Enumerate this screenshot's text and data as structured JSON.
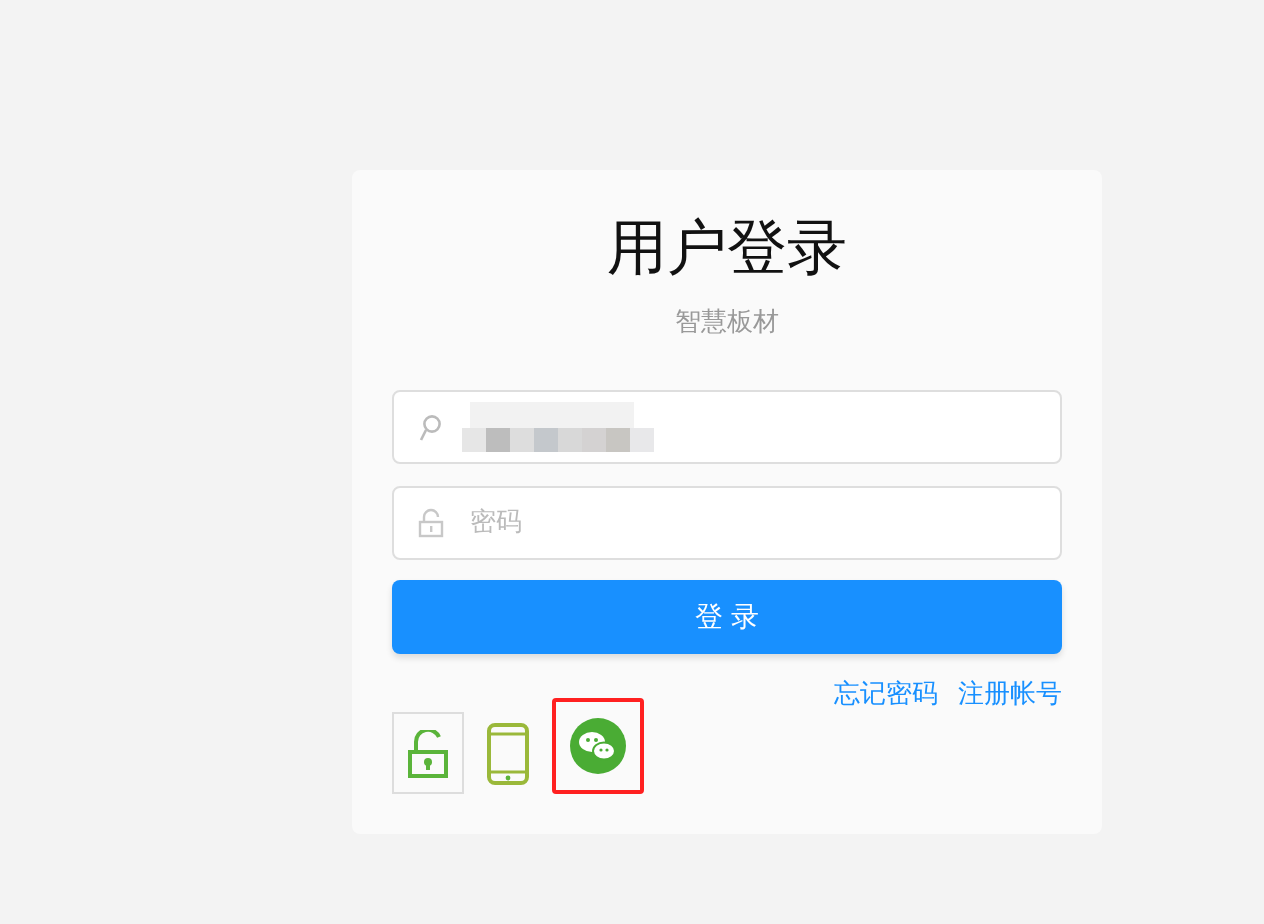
{
  "title": "用户登录",
  "subtitle": "智慧板材",
  "username_field": {
    "redacted": true
  },
  "password_field": {
    "placeholder": "密码"
  },
  "login_button": "登 录",
  "links": [
    "忘记密码",
    "注册帐号"
  ],
  "login_methods": [
    {
      "kind": "password",
      "selected": true,
      "highlighted": false
    },
    {
      "kind": "phone",
      "selected": false,
      "highlighted": false
    },
    {
      "kind": "wechat",
      "selected": false,
      "highlighted": true
    }
  ]
}
